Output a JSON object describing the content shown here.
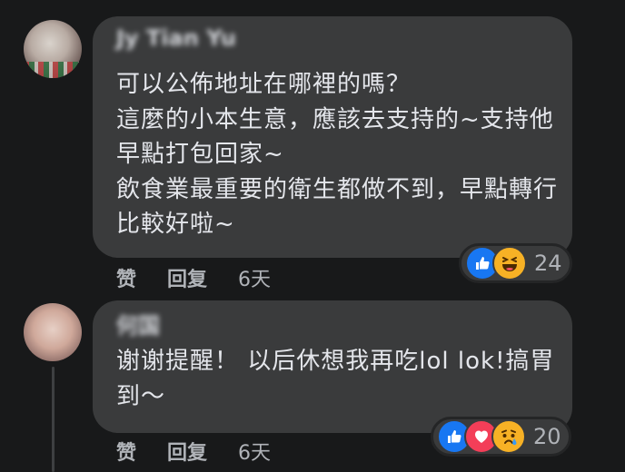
{
  "comments": [
    {
      "author": "Jy Tian Yu",
      "text": "可以公佈地址在哪裡的嗎？\n這麼的小本生意，應該去支持的~支持他早點打包回家~\n飲食業最重要的衛生都做不到，早點轉行比較好啦~",
      "reactions": [
        "like",
        "haha"
      ],
      "reaction_count": "24",
      "like_label": "赞",
      "reply_label": "回复",
      "time": "6天"
    },
    {
      "author": "何国",
      "text": "谢谢提醒！ 以后休想我再吃lol lok!搞胃到～",
      "reactions": [
        "like",
        "love",
        "sad"
      ],
      "reaction_count": "20",
      "like_label": "赞",
      "reply_label": "回复",
      "time": "6天"
    }
  ],
  "colors": {
    "background": "#18191a",
    "bubble": "#3a3b3c",
    "text": "#e4e6eb",
    "muted": "#b0b3b8",
    "like": "#1877f2",
    "love": "#f33e58",
    "emoji_yellow": "#f7b125"
  }
}
